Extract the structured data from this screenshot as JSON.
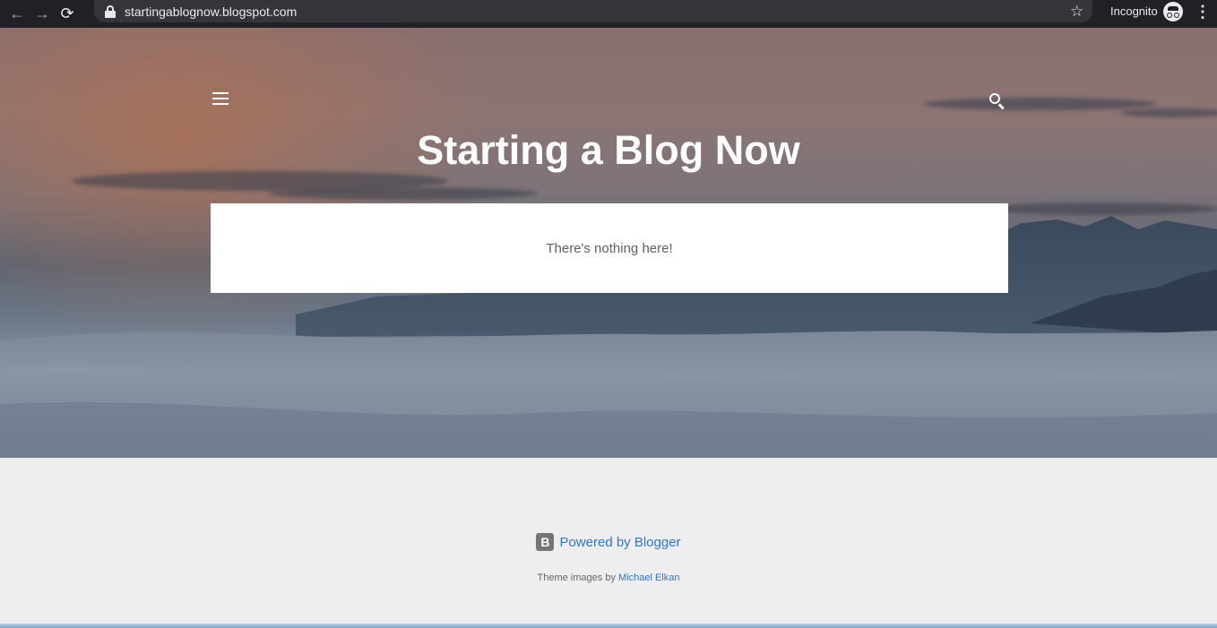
{
  "browser": {
    "url": "startingablognow.blogspot.com",
    "incognito_label": "Incognito",
    "back_glyph": "←",
    "forward_glyph": "→",
    "reload_glyph": "⟳",
    "star_glyph": "☆",
    "menu_glyph": "⋮"
  },
  "header": {
    "blog_title": "Starting a Blog Now",
    "menu_icon": "hamburger-icon",
    "search_icon": "search-icon"
  },
  "main": {
    "empty_message": "There's nothing here!"
  },
  "footer": {
    "powered_by": "Powered by Blogger",
    "blogger_letter": "B",
    "theme_prefix": "Theme images by ",
    "theme_author": "Michael Elkan"
  },
  "colors": {
    "link": "#2d76d2",
    "footer_bg": "#eeeeee",
    "chrome_bg": "#202124"
  }
}
